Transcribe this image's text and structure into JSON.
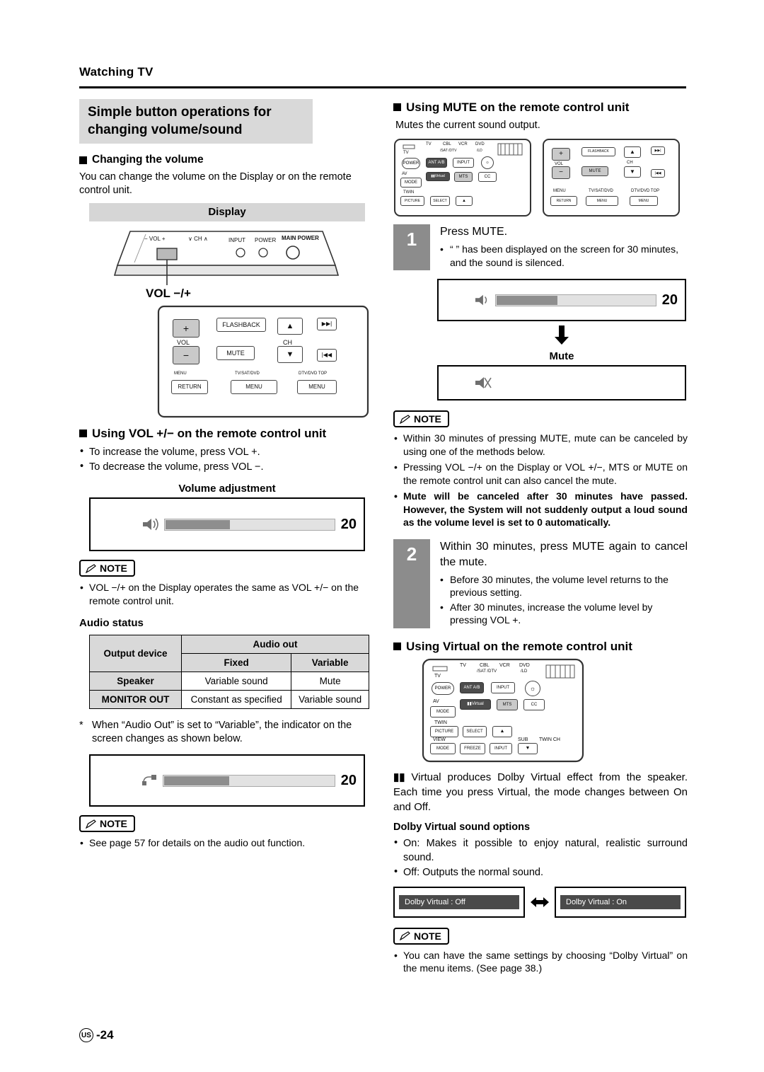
{
  "header": {
    "chapter": "Watching TV"
  },
  "left": {
    "block_title_line1": "Simple button operations for",
    "block_title_line2": "changing volume/sound",
    "changing_volume_heading": "Changing the volume",
    "changing_volume_text": "You can change the volume on the Display or on the remote control unit.",
    "display_caption": "Display",
    "vol_caption": "VOL −/+",
    "using_vol_heading": "Using VOL +/− on the remote control unit",
    "using_vol_bullets": [
      "To increase the volume, press VOL +.",
      "To decrease the volume, press VOL −."
    ],
    "volume_adjustment_caption": "Volume adjustment",
    "osd_volume_value": "20",
    "note_label": "NOTE",
    "note1": "VOL −/+ on the Display operates the same as VOL +/− on the remote control unit.",
    "audio_status_caption": "Audio status",
    "table": {
      "col_output_device": "Output device",
      "col_audio_out": "Audio out",
      "col_fixed": "Fixed",
      "col_variable": "Variable",
      "rows": [
        {
          "device": "Speaker",
          "fixed": "Variable sound",
          "variable": "Mute"
        },
        {
          "device": "MONITOR OUT",
          "fixed": "Constant as specified",
          "variable": "Variable sound"
        }
      ]
    },
    "asterisk_note": "When “Audio Out” is set to “Variable”, the indicator on the screen changes as shown below.",
    "osd_audioout_value": "20",
    "note2": "See page 57 for details on the audio out function."
  },
  "right": {
    "mute_heading": "Using MUTE on the remote control unit",
    "mute_text": "Mutes the current sound output.",
    "step1_num": "1",
    "step1_lead": "Press MUTE.",
    "step1_sub": "“ ” has been displayed on the screen for 30 minutes, and the sound is silenced.",
    "osd_mute_value": "20",
    "mute_label": "Mute",
    "note_label": "NOTE",
    "note_mute_1": "Within 30 minutes of pressing MUTE, mute can be canceled by using one of the methods below.",
    "note_mute_1_sub": "Pressing VOL −/+ on the Display or VOL +/−, MTS or MUTE on the remote control unit can also cancel the mute.",
    "note_mute_2": "Mute will be canceled after 30 minutes have passed. However, the System will not suddenly output a loud sound as the volume level is set to 0 automatically.",
    "step2_num": "2",
    "step2_lead": "Within 30 minutes, press MUTE again to cancel the mute.",
    "step2_subs": [
      "Before 30 minutes, the volume level returns to the previous setting.",
      "After 30 minutes, increase the volume level by pressing VOL +."
    ],
    "virtual_heading": "Using      Virtual on the remote control unit",
    "virtual_body": "Virtual produces Dolby Virtual effect from the speaker. Each time you press      Virtual, the mode changes between On and Off.",
    "dolby_options_caption": "Dolby Virtual sound options",
    "dolby_on": "On:  Makes it possible to enjoy natural, realistic surround sound.",
    "dolby_off": "Off:  Outputs the normal sound.",
    "osd_virtual_off": "Dolby Virtual : Off",
    "osd_virtual_on": "Dolby Virtual : On",
    "note_virtual": "You can have the same settings by choosing “Dolby Virtual” on the menu items. (See page 38.)"
  },
  "remote_labels": {
    "flashback": "FLASHBACK",
    "vol": "VOL",
    "ch": "CH",
    "mute": "MUTE",
    "menu": "MENU",
    "return": "RETURN",
    "tv_sat_dvd": "TV/SAT/DVD",
    "dtv_dvd_top": "DTV/DVD TOP",
    "power": "POWER",
    "tv": "TV",
    "cbl": "CBL",
    "vcr": "VCR",
    "dvd": "DVD",
    "sat_dtv": "/SAT /DTV",
    "ld": "/LD",
    "antab": "ANT A/B",
    "input": "INPUT",
    "av_mode": "AV MODE",
    "virtual": "Virtual",
    "mts": "MTS",
    "cc": "CC",
    "twin_picture": "TWIN PICTURE",
    "select": "SELECT",
    "view_mode": "VIEW MODE",
    "freeze": "FREEZE",
    "sub": "SUB",
    "twin_ch": "TWIN CH"
  },
  "display_labels": {
    "vol": "− VOL +",
    "ch": "∨ CH ∧",
    "input": "INPUT",
    "power": "POWER",
    "main_power": "MAIN POWER"
  },
  "footer": {
    "region": "US",
    "page": "-24"
  }
}
